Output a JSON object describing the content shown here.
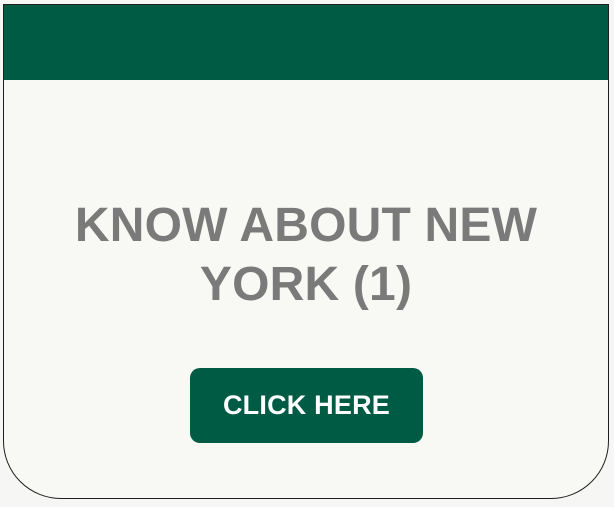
{
  "card": {
    "title_line1": "KNOW ABOUT NEW",
    "title_line2": "YORK (1)",
    "cta_label": "CLICK HERE"
  },
  "colors": {
    "brand_green": "#005b45",
    "title_gray": "#7a7a7a",
    "card_background": "#f8f8f4"
  }
}
